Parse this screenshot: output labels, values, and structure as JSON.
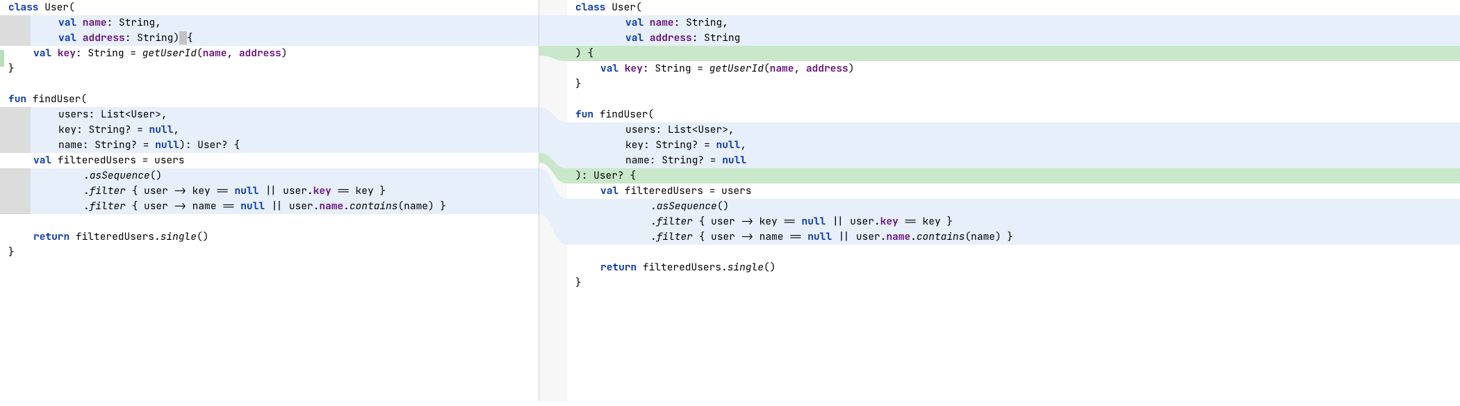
{
  "colors": {
    "highlight_blue": "#e7effa",
    "highlight_green": "#c9e8c9",
    "gutter_gray": "#dcdcdc",
    "keyword": "#0033B3",
    "member": "#660E7A"
  },
  "left_pane": {
    "lines": [
      {
        "bg": "white",
        "gutter": false,
        "tokens": [
          [
            "kw",
            "class"
          ],
          [
            "ident",
            " User("
          ]
        ]
      },
      {
        "bg": "blue",
        "gutter": true,
        "indent": 2,
        "tokens": [
          [
            "kw",
            "val"
          ],
          [
            "decl",
            " name"
          ],
          [
            "punc",
            ": String,"
          ]
        ]
      },
      {
        "bg": "blue",
        "gutter": true,
        "indent": 2,
        "tokens": [
          [
            "kw",
            "val"
          ],
          [
            "decl",
            " address"
          ],
          [
            "punc",
            ": String)"
          ],
          [
            "caret",
            " "
          ],
          [
            "punc",
            "{"
          ]
        ]
      },
      {
        "bg": "white",
        "gutter": false,
        "indent": 1,
        "tokens": [
          [
            "kw",
            "val"
          ],
          [
            "decl",
            " key"
          ],
          [
            "punc",
            ": String = "
          ],
          [
            "fname",
            "getUserId"
          ],
          [
            "punc",
            "("
          ],
          [
            "decl",
            "name"
          ],
          [
            "punc",
            ", "
          ],
          [
            "decl",
            "address"
          ],
          [
            "punc",
            ")"
          ]
        ]
      },
      {
        "bg": "white",
        "gutter": false,
        "tokens": [
          [
            "punc",
            "}"
          ]
        ]
      },
      {
        "bg": "white",
        "gutter": false,
        "tokens": []
      },
      {
        "bg": "white",
        "gutter": false,
        "tokens": [
          [
            "kw",
            "fun"
          ],
          [
            "ident",
            " findUser("
          ]
        ]
      },
      {
        "bg": "blue",
        "gutter": true,
        "indent": 2,
        "tokens": [
          [
            "ident",
            "users: List<User>,"
          ]
        ]
      },
      {
        "bg": "blue",
        "gutter": true,
        "indent": 2,
        "tokens": [
          [
            "ident",
            "key: String? = "
          ],
          [
            "kw",
            "null"
          ],
          [
            "punc",
            ","
          ]
        ]
      },
      {
        "bg": "blue",
        "gutter": true,
        "indent": 2,
        "tokens": [
          [
            "ident",
            "name: String? = "
          ],
          [
            "kw",
            "null"
          ],
          [
            "punc",
            "): User? {"
          ]
        ]
      },
      {
        "bg": "white",
        "gutter": false,
        "indent": 1,
        "tokens": [
          [
            "kw",
            "val"
          ],
          [
            "ident",
            " filteredUsers = users"
          ]
        ]
      },
      {
        "bg": "blue",
        "gutter": true,
        "indent": 3,
        "tokens": [
          [
            "punc",
            "."
          ],
          [
            "fname",
            "asSequence"
          ],
          [
            "punc",
            "()"
          ]
        ]
      },
      {
        "bg": "blue",
        "gutter": true,
        "indent": 3,
        "tokens": [
          [
            "punc",
            "."
          ],
          [
            "fname",
            "filter"
          ],
          [
            "punc",
            " { "
          ],
          [
            "ident",
            "user -> key == "
          ],
          [
            "kw",
            "null"
          ],
          [
            "ident",
            " || user."
          ],
          [
            "decl",
            "key"
          ],
          [
            "ident",
            " == key }"
          ]
        ]
      },
      {
        "bg": "blue",
        "gutter": true,
        "indent": 3,
        "tokens": [
          [
            "punc",
            "."
          ],
          [
            "fname",
            "filter"
          ],
          [
            "punc",
            " { "
          ],
          [
            "ident",
            "user -> name == "
          ],
          [
            "kw",
            "null"
          ],
          [
            "ident",
            " || user."
          ],
          [
            "decl",
            "name"
          ],
          [
            "punc",
            "."
          ],
          [
            "fname",
            "contains"
          ],
          [
            "punc",
            "(name) }"
          ]
        ]
      },
      {
        "bg": "white",
        "gutter": false,
        "tokens": []
      },
      {
        "bg": "white",
        "gutter": false,
        "indent": 1,
        "tokens": [
          [
            "kw",
            "return"
          ],
          [
            "ident",
            " filteredUsers."
          ],
          [
            "fname",
            "single"
          ],
          [
            "punc",
            "()"
          ]
        ]
      },
      {
        "bg": "white",
        "gutter": false,
        "tokens": [
          [
            "punc",
            "}"
          ]
        ]
      }
    ]
  },
  "right_pane": {
    "lines": [
      {
        "bg": "white",
        "tokens": [
          [
            "kw",
            "class"
          ],
          [
            "ident",
            " User("
          ]
        ]
      },
      {
        "bg": "blue",
        "indent": 2,
        "tokens": [
          [
            "kw",
            "val"
          ],
          [
            "decl",
            " name"
          ],
          [
            "punc",
            ": String,"
          ]
        ]
      },
      {
        "bg": "blue",
        "indent": 2,
        "tokens": [
          [
            "kw",
            "val"
          ],
          [
            "decl",
            " address"
          ],
          [
            "punc",
            ": String"
          ]
        ]
      },
      {
        "bg": "green",
        "tokens": [
          [
            "punc",
            ") {"
          ]
        ]
      },
      {
        "bg": "white",
        "indent": 1,
        "tokens": [
          [
            "kw",
            "val"
          ],
          [
            "decl",
            " key"
          ],
          [
            "punc",
            ": String = "
          ],
          [
            "fname",
            "getUserId"
          ],
          [
            "punc",
            "("
          ],
          [
            "decl",
            "name"
          ],
          [
            "punc",
            ", "
          ],
          [
            "decl",
            "address"
          ],
          [
            "punc",
            ")"
          ]
        ]
      },
      {
        "bg": "white",
        "tokens": [
          [
            "punc",
            "}"
          ]
        ]
      },
      {
        "bg": "white",
        "tokens": []
      },
      {
        "bg": "white",
        "tokens": [
          [
            "kw",
            "fun"
          ],
          [
            "ident",
            " findUser("
          ]
        ]
      },
      {
        "bg": "blue",
        "indent": 2,
        "tokens": [
          [
            "ident",
            "users: List<User>,"
          ]
        ]
      },
      {
        "bg": "blue",
        "indent": 2,
        "tokens": [
          [
            "ident",
            "key: String? = "
          ],
          [
            "kw",
            "null"
          ],
          [
            "punc",
            ","
          ]
        ]
      },
      {
        "bg": "blue",
        "indent": 2,
        "tokens": [
          [
            "ident",
            "name: String? = "
          ],
          [
            "kw",
            "null"
          ]
        ]
      },
      {
        "bg": "green",
        "tokens": [
          [
            "punc",
            "): User? {"
          ]
        ]
      },
      {
        "bg": "white",
        "indent": 1,
        "tokens": [
          [
            "kw",
            "val"
          ],
          [
            "ident",
            " filteredUsers = users"
          ]
        ]
      },
      {
        "bg": "blue",
        "indent": 3,
        "tokens": [
          [
            "punc",
            "."
          ],
          [
            "fname",
            "asSequence"
          ],
          [
            "punc",
            "()"
          ]
        ]
      },
      {
        "bg": "blue",
        "indent": 3,
        "tokens": [
          [
            "punc",
            "."
          ],
          [
            "fname",
            "filter"
          ],
          [
            "punc",
            " { "
          ],
          [
            "ident",
            "user -> key == "
          ],
          [
            "kw",
            "null"
          ],
          [
            "ident",
            " || user."
          ],
          [
            "decl",
            "key"
          ],
          [
            "ident",
            " == key }"
          ]
        ]
      },
      {
        "bg": "blue",
        "indent": 3,
        "tokens": [
          [
            "punc",
            "."
          ],
          [
            "fname",
            "filter"
          ],
          [
            "punc",
            " { "
          ],
          [
            "ident",
            "user -> name == "
          ],
          [
            "kw",
            "null"
          ],
          [
            "ident",
            " || user."
          ],
          [
            "decl",
            "name"
          ],
          [
            "punc",
            "."
          ],
          [
            "fname",
            "contains"
          ],
          [
            "punc",
            "(name) }"
          ]
        ]
      },
      {
        "bg": "white",
        "tokens": []
      },
      {
        "bg": "white",
        "indent": 1,
        "tokens": [
          [
            "kw",
            "return"
          ],
          [
            "ident",
            " filteredUsers."
          ],
          [
            "fname",
            "single"
          ],
          [
            "punc",
            "()"
          ]
        ]
      },
      {
        "bg": "white",
        "tokens": [
          [
            "punc",
            "}"
          ]
        ]
      }
    ]
  }
}
